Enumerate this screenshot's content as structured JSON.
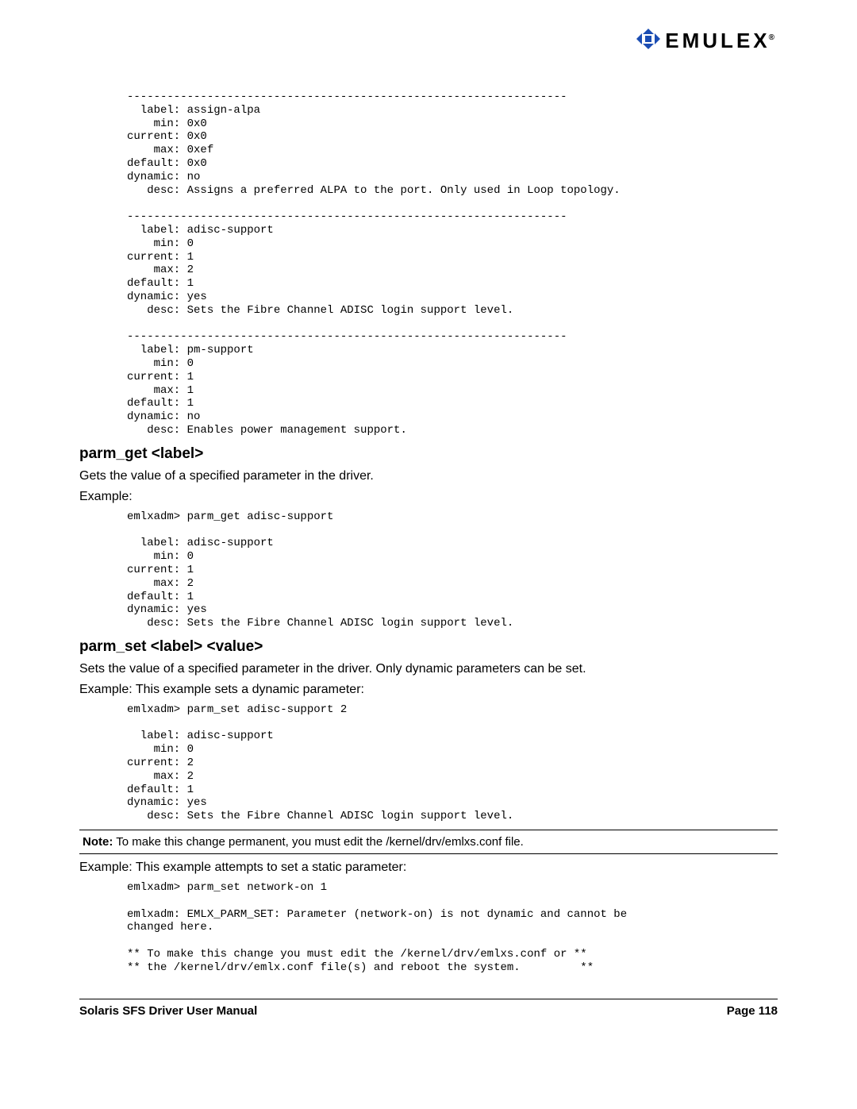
{
  "brand": {
    "name": "EMULEX"
  },
  "codeblock1": "------------------------------------------------------------------\n  label: assign-alpa\n    min: 0x0\ncurrent: 0x0\n    max: 0xef\ndefault: 0x0\ndynamic: no\n   desc: Assigns a preferred ALPA to the port. Only used in Loop topology.\n\n------------------------------------------------------------------\n  label: adisc-support\n    min: 0\ncurrent: 1\n    max: 2\ndefault: 1\ndynamic: yes\n   desc: Sets the Fibre Channel ADISC login support level.\n\n------------------------------------------------------------------\n  label: pm-support\n    min: 0\ncurrent: 1\n    max: 1\ndefault: 1\ndynamic: no\n   desc: Enables power management support.",
  "section1": {
    "title": "parm_get <label>",
    "desc": "Gets the value of a specified parameter in the driver.",
    "example_label": "Example:"
  },
  "codeblock2": "emlxadm> parm_get adisc-support\n\n  label: adisc-support\n    min: 0\ncurrent: 1\n    max: 2\ndefault: 1\ndynamic: yes\n   desc: Sets the Fibre Channel ADISC login support level.",
  "section2": {
    "title": "parm_set <label> <value>",
    "desc": "Sets the value of a specified parameter in the driver. Only dynamic parameters can be set.",
    "example_label": "Example: This example sets a dynamic parameter:"
  },
  "codeblock3": "emlxadm> parm_set adisc-support 2\n\n  label: adisc-support\n    min: 0\ncurrent: 2\n    max: 2\ndefault: 1\ndynamic: yes\n   desc: Sets the Fibre Channel ADISC login support level.",
  "note": {
    "lead": "Note:",
    "text": " To make this change permanent, you must edit the /kernel/drv/emlxs.conf file."
  },
  "section3": {
    "example_label": "Example: This example attempts to set a static parameter:"
  },
  "codeblock4": "emlxadm> parm_set network-on 1\n\nemlxadm: EMLX_PARM_SET: Parameter (network-on) is not dynamic and cannot be\nchanged here.\n\n** To make this change you must edit the /kernel/drv/emlxs.conf or **\n** the /kernel/drv/emlx.conf file(s) and reboot the system.         **",
  "footer": {
    "left": "Solaris SFS Driver User Manual",
    "right": "Page 118"
  }
}
